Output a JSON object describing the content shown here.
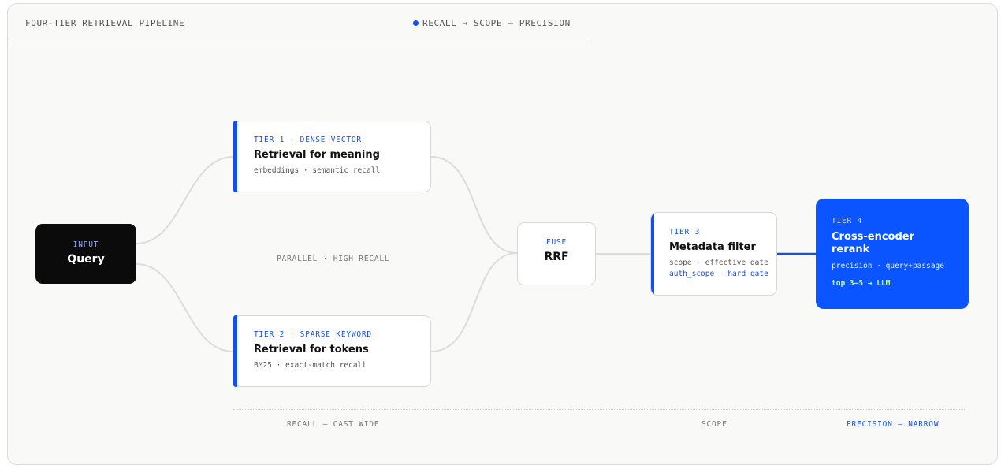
{
  "header": {
    "title": "FOUR-TIER RETRIEVAL PIPELINE",
    "legend": "RECALL → SCOPE → PRECISION"
  },
  "colors": {
    "accent": "#1450ee",
    "input_bg": "#0b0b0b",
    "tier4_bg": "#0a55ff",
    "tier4_highlight": "#c5ff7a"
  },
  "nodes": {
    "input": {
      "tag": "INPUT",
      "title": "Query"
    },
    "tier1": {
      "tag": "TIER 1 · DENSE VECTOR",
      "title": "Retrieval for meaning",
      "sub": "embeddings · semantic recall"
    },
    "tier2": {
      "tag": "TIER 2 · SPARSE KEYWORD",
      "title": "Retrieval for tokens",
      "sub": "BM25 · exact-match recall"
    },
    "fuse": {
      "tag": "FUSE",
      "title": "RRF"
    },
    "tier3": {
      "tag": "TIER 3",
      "title": "Metadata filter",
      "sub": "scope · effective date",
      "sub2": "auth_scope — hard gate"
    },
    "tier4": {
      "tag": "TIER 4",
      "title_line1": "Cross-encoder",
      "title_line2": "rerank",
      "sub": "precision · query+passage",
      "highlight": "top 3–5 → LLM"
    }
  },
  "labels": {
    "parallel": "PARALLEL · HIGH RECALL",
    "recall": "RECALL — CAST WIDE",
    "scope": "SCOPE",
    "precision": "PRECISION — NARROW"
  }
}
